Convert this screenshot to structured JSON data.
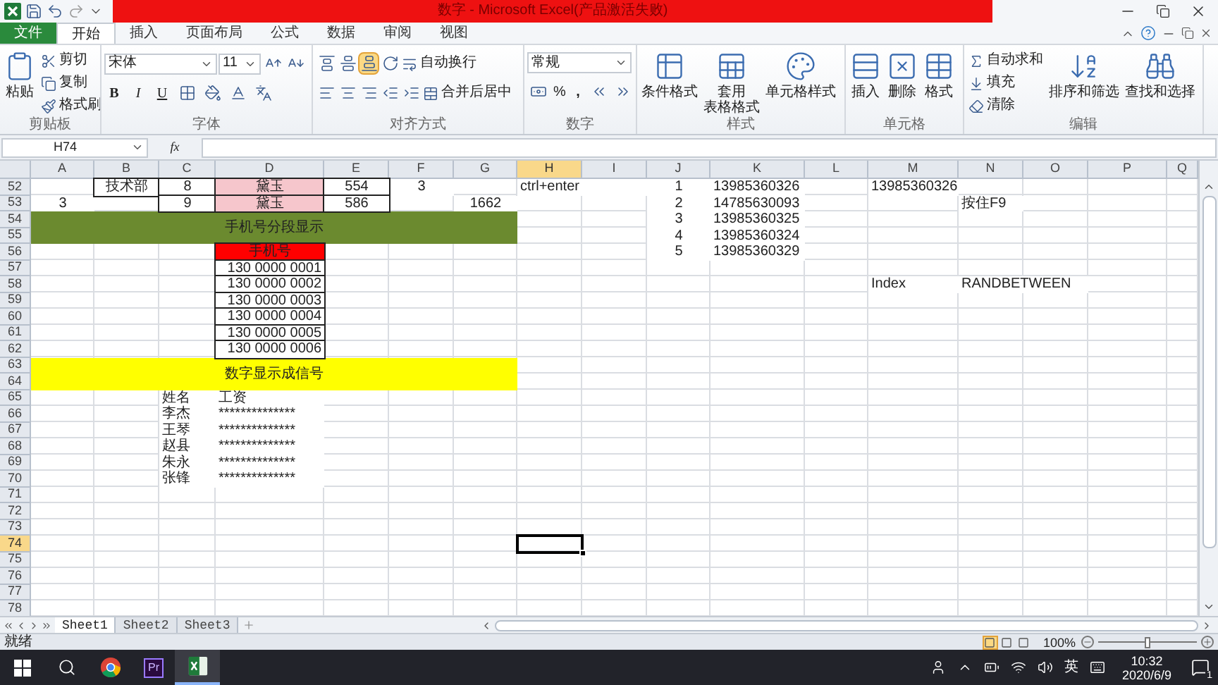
{
  "window": {
    "title": "数字 - Microsoft Excel(产品激活失败)"
  },
  "ribbon_tabs": [
    {
      "label": "文件",
      "kind": "file",
      "selected": false
    },
    {
      "label": "开始",
      "kind": "tab",
      "selected": true
    },
    {
      "label": "插入",
      "kind": "tab",
      "selected": false
    },
    {
      "label": "页面布局",
      "kind": "tab",
      "selected": false
    },
    {
      "label": "公式",
      "kind": "tab",
      "selected": false
    },
    {
      "label": "数据",
      "kind": "tab",
      "selected": false
    },
    {
      "label": "审阅",
      "kind": "tab",
      "selected": false
    },
    {
      "label": "视图",
      "kind": "tab",
      "selected": false
    }
  ],
  "ribbon": {
    "clipboard": {
      "label": "剪贴板",
      "paste": "粘贴",
      "cut": "剪切",
      "copy": "复制",
      "format_painter": "格式刷"
    },
    "font": {
      "label": "字体",
      "font_name": "宋体",
      "font_size": "11",
      "bold": "B",
      "italic": "I",
      "underline": "U"
    },
    "alignment": {
      "label": "对齐方式",
      "wrap_text": "自动换行",
      "merge_center": "合并后居中",
      "vertical_align": [
        {
          "selected": false
        },
        {
          "selected": false
        },
        {
          "selected": true
        }
      ]
    },
    "number": {
      "label": "数字",
      "format": "常规",
      "percent": "%",
      "comma": ","
    },
    "styles": {
      "label": "样式",
      "buttons": [
        {
          "lines": [
            "条件格式"
          ]
        },
        {
          "lines": [
            "套用",
            "表格格式"
          ]
        },
        {
          "lines": [
            "单元格样式"
          ]
        }
      ]
    },
    "cells": {
      "label": "单元格",
      "buttons": [
        "插入",
        "删除",
        "格式"
      ]
    },
    "editing": {
      "label": "编辑",
      "autosum": "自动求和",
      "fill": "填充",
      "clear": "清除",
      "sort": "排序和筛选",
      "find": "查找和选择"
    }
  },
  "formula_bar": {
    "name_box": "H74",
    "fx": "fx"
  },
  "columns": [
    {
      "label": "A",
      "selected": false
    },
    {
      "label": "B",
      "selected": false
    },
    {
      "label": "C",
      "selected": false
    },
    {
      "label": "D",
      "selected": false
    },
    {
      "label": "E",
      "selected": false
    },
    {
      "label": "F",
      "selected": false
    },
    {
      "label": "G",
      "selected": false
    },
    {
      "label": "H",
      "selected": true
    },
    {
      "label": "I",
      "selected": false
    },
    {
      "label": "J",
      "selected": false
    },
    {
      "label": "K",
      "selected": false
    },
    {
      "label": "L",
      "selected": false
    },
    {
      "label": "M",
      "selected": false
    },
    {
      "label": "N",
      "selected": false
    },
    {
      "label": "O",
      "selected": false
    },
    {
      "label": "P",
      "selected": false
    },
    {
      "label": "Q",
      "selected": false
    }
  ],
  "rows": [
    {
      "number": "52",
      "selected": false,
      "cells": {
        "B": {
          "text": "技术部",
          "kind": "centered",
          "border": true,
          "selected": false
        },
        "C": {
          "text": "8",
          "kind": "centered",
          "border": true,
          "selected": false
        },
        "D": {
          "text": "黛玉",
          "kind": "centered",
          "border": true,
          "color": "#f6c6cc",
          "selected": false
        },
        "E": {
          "text": "554",
          "kind": "centered",
          "border": true,
          "selected": false
        },
        "F": {
          "text": "3",
          "kind": "centered",
          "selected": false
        },
        "H": {
          "text": "ctrl+enter",
          "kind": "wide",
          "selected": false
        },
        "J": {
          "text": "1",
          "kind": "centered",
          "selected": false
        },
        "K": {
          "text": "13985360326",
          "kind": "left",
          "selected": false
        },
        "M": {
          "text": "13985360326",
          "kind": "left",
          "selected": false
        }
      }
    },
    {
      "number": "53",
      "selected": false,
      "cells": {
        "A": {
          "text": "3",
          "kind": "centered",
          "selected": false
        },
        "C": {
          "text": "9",
          "kind": "centered",
          "border": true,
          "selected": false
        },
        "D": {
          "text": "黛玉",
          "kind": "centered",
          "border": true,
          "color": "#f6c6cc",
          "selected": false
        },
        "E": {
          "text": "586",
          "kind": "centered",
          "border": true,
          "selected": false
        },
        "G": {
          "text": "1662",
          "kind": "centered",
          "selected": false
        },
        "J": {
          "text": "2",
          "kind": "centered",
          "selected": false
        },
        "K": {
          "text": "14785630093",
          "kind": "left",
          "selected": false
        },
        "N": {
          "text": "按住F9",
          "kind": "left",
          "selected": false
        }
      }
    },
    {
      "number": "54",
      "selected": false,
      "cells": {
        "A": {
          "text": "手机号分段显示",
          "kind": "band",
          "color": "#6b8a2f",
          "selected": false
        },
        "J": {
          "text": "3",
          "kind": "centered",
          "selected": false
        },
        "K": {
          "text": "13985360325",
          "kind": "left",
          "selected": false
        }
      }
    },
    {
      "number": "55",
      "selected": false,
      "cells": {
        "J": {
          "text": "4",
          "kind": "centered",
          "selected": false
        },
        "K": {
          "text": "13985360324",
          "kind": "left",
          "selected": false
        }
      }
    },
    {
      "number": "56",
      "selected": false,
      "cells": {
        "D": {
          "text": "手机号",
          "kind": "centered",
          "border": true,
          "color": "#ff0000",
          "selected": false
        },
        "J": {
          "text": "5",
          "kind": "centered",
          "selected": false
        },
        "K": {
          "text": "13985360329",
          "kind": "left",
          "selected": false
        }
      }
    },
    {
      "number": "57",
      "selected": false,
      "cells": {
        "D": {
          "text": "130 0000 0001",
          "kind": "right",
          "border": true,
          "selected": false
        }
      }
    },
    {
      "number": "58",
      "selected": false,
      "cells": {
        "D": {
          "text": "130 0000 0002",
          "kind": "right",
          "border": true,
          "selected": false
        },
        "M": {
          "text": "Index",
          "kind": "left",
          "selected": false
        },
        "N": {
          "text": "RANDBETWEEN",
          "kind": "wide",
          "selected": false
        }
      }
    },
    {
      "number": "59",
      "selected": false,
      "cells": {
        "D": {
          "text": "130 0000 0003",
          "kind": "right",
          "border": true,
          "selected": false
        }
      }
    },
    {
      "number": "60",
      "selected": false,
      "cells": {
        "D": {
          "text": "130 0000 0004",
          "kind": "right",
          "border": true,
          "selected": false
        }
      }
    },
    {
      "number": "61",
      "selected": false,
      "cells": {
        "D": {
          "text": "130 0000 0005",
          "kind": "right",
          "border": true,
          "selected": false
        }
      }
    },
    {
      "number": "62",
      "selected": false,
      "cells": {
        "D": {
          "text": "130 0000 0006",
          "kind": "right",
          "border": true,
          "selected": false
        }
      }
    },
    {
      "number": "63",
      "selected": false,
      "cells": {
        "A": {
          "text": "数字显示成信号",
          "kind": "band",
          "color": "#ffff00",
          "selected": false
        }
      }
    },
    {
      "number": "64",
      "selected": false
    },
    {
      "number": "65",
      "selected": false,
      "cells": {
        "C": {
          "text": "姓名",
          "kind": "left",
          "selected": false
        },
        "D": {
          "text": "工资",
          "kind": "left",
          "selected": false
        }
      }
    },
    {
      "number": "66",
      "selected": false,
      "cells": {
        "C": {
          "text": "李杰",
          "kind": "left",
          "selected": false
        },
        "D": {
          "text": "**************",
          "kind": "left",
          "selected": false
        }
      }
    },
    {
      "number": "67",
      "selected": false,
      "cells": {
        "C": {
          "text": "王琴",
          "kind": "left",
          "selected": false
        },
        "D": {
          "text": "**************",
          "kind": "left",
          "selected": false
        }
      }
    },
    {
      "number": "68",
      "selected": false,
      "cells": {
        "C": {
          "text": "赵县",
          "kind": "left",
          "selected": false
        },
        "D": {
          "text": "**************",
          "kind": "left",
          "selected": false
        }
      }
    },
    {
      "number": "69",
      "selected": false,
      "cells": {
        "C": {
          "text": "朱永",
          "kind": "left",
          "selected": false
        },
        "D": {
          "text": "**************",
          "kind": "left",
          "selected": false
        }
      }
    },
    {
      "number": "70",
      "selected": false,
      "cells": {
        "C": {
          "text": "张锋",
          "kind": "left",
          "selected": false
        },
        "D": {
          "text": "**************",
          "kind": "left",
          "selected": false
        }
      }
    },
    {
      "number": "71",
      "selected": false
    },
    {
      "number": "72",
      "selected": false
    },
    {
      "number": "73",
      "selected": false
    },
    {
      "number": "74",
      "selected": true,
      "cells": {
        "H": {
          "kind": "left",
          "selected": true
        }
      }
    },
    {
      "number": "75",
      "selected": false
    },
    {
      "number": "76",
      "selected": false
    },
    {
      "number": "77",
      "selected": false
    },
    {
      "number": "78",
      "selected": false
    }
  ],
  "sheet_tabs": [
    {
      "label": "Sheet1",
      "selected": true
    },
    {
      "label": "Sheet2",
      "selected": false
    },
    {
      "label": "Sheet3",
      "selected": false
    }
  ],
  "status_bar": {
    "status": "就绪",
    "views": [
      {
        "selected": true
      },
      {
        "selected": false
      },
      {
        "selected": false
      }
    ],
    "zoom": "100%",
    "zoom_slider": {
      "level": 0.5
    }
  },
  "taskbar": {
    "premiere": "Pr",
    "input_method": "英",
    "time": "10:32",
    "date": "2020/6/9",
    "notifications": "1"
  }
}
